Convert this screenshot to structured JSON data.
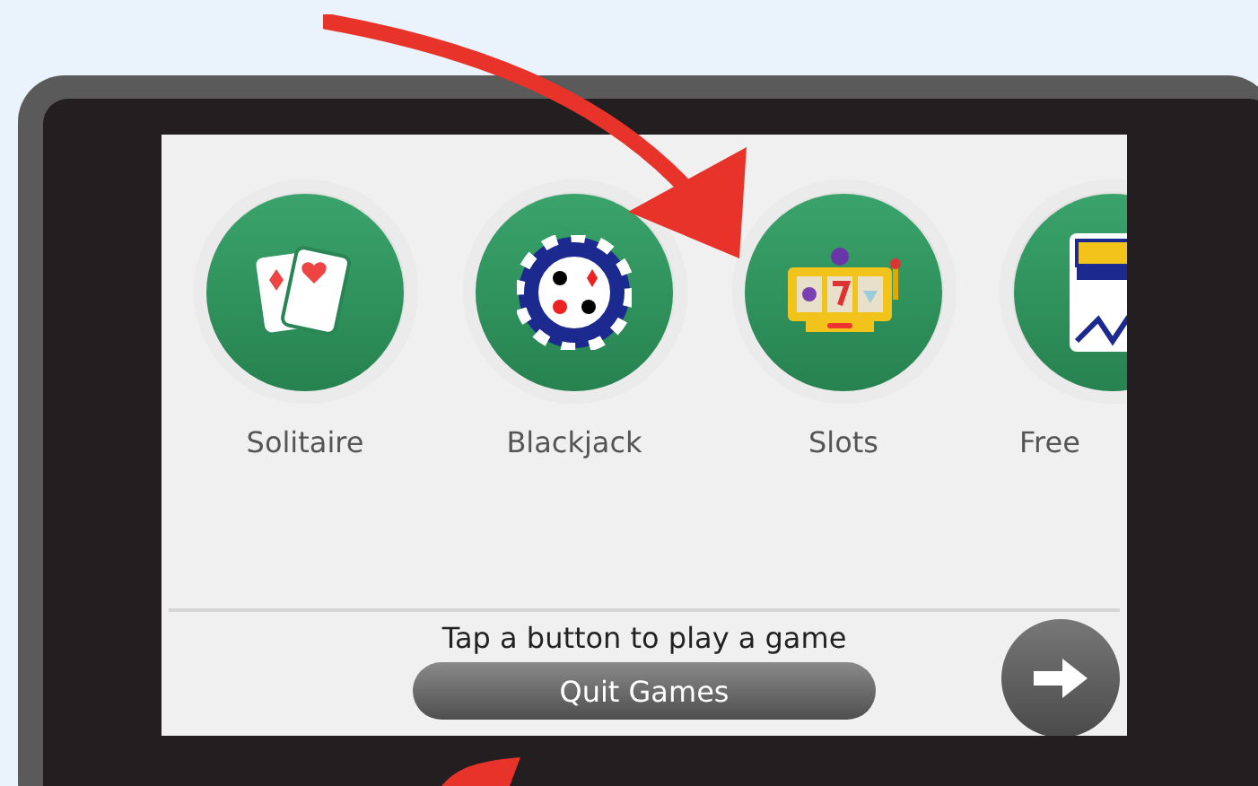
{
  "games": [
    {
      "label": "Solitaire",
      "kind": "cards"
    },
    {
      "label": "Blackjack",
      "kind": "chip"
    },
    {
      "label": "Slots",
      "kind": "slots"
    },
    {
      "label": "Free",
      "kind": "jack"
    }
  ],
  "prompt": "Tap a button to play a game",
  "quit_button": "Quit Games"
}
